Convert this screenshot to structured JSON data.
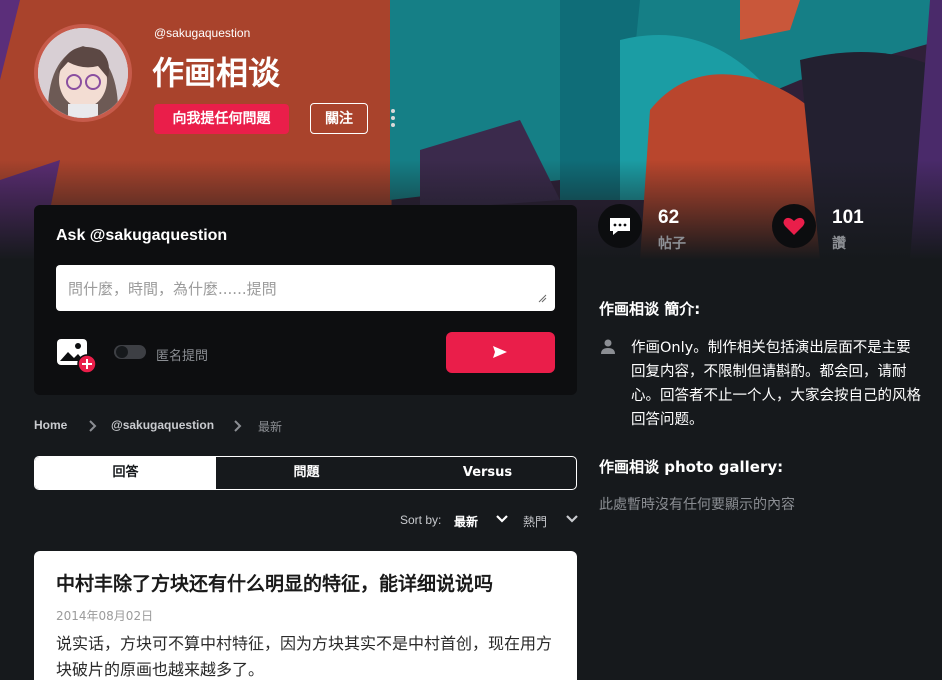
{
  "profile": {
    "handle": "@sakugaquestion",
    "name": "作画相谈",
    "ask_button": "向我提任何問題",
    "follow_button": "關注"
  },
  "ask_card": {
    "title": "Ask @sakugaquestion",
    "placeholder": "問什麼，時間，為什麼......提問",
    "anonymous_label": "匿名提問"
  },
  "breadcrumb": [
    "Home",
    "@sakugaquestion",
    "最新"
  ],
  "tabs": [
    "回答",
    "問題",
    "Versus"
  ],
  "sort": {
    "label": "Sort by:",
    "option1": "最新",
    "option2": "熱門"
  },
  "post": {
    "title": "中村丰除了方块还有什么明显的特征，能详细说说吗",
    "date": "2014年08月02日",
    "body": "说实话，方块可不算中村特征，因为方块其实不是中村首创，现在用方块破片的原画也越来越多了。"
  },
  "stats": {
    "posts_count": "62",
    "posts_label": "帖子",
    "likes_count": "101",
    "likes_label": "讚"
  },
  "about": {
    "heading": "作画相谈 簡介:",
    "text": "作画Only。制作相关包括演出层面不是主要回复内容，不限制但请斟酌。都会回，请耐心。回答者不止一个人，大家会按自己的风格回答问题。"
  },
  "gallery": {
    "heading": "作画相谈 photo gallery:",
    "empty": "此處暫時沒有任何要顯示的內容"
  },
  "colors": {
    "accent": "#ea1e4a",
    "background": "#16191c",
    "card_dark": "#0d0e10"
  },
  "icons": [
    "comment-icon",
    "heart-icon",
    "person-icon",
    "photo-add-icon",
    "send-icon",
    "chevron-right-icon",
    "chevron-down-icon",
    "more-vertical-icon"
  ]
}
